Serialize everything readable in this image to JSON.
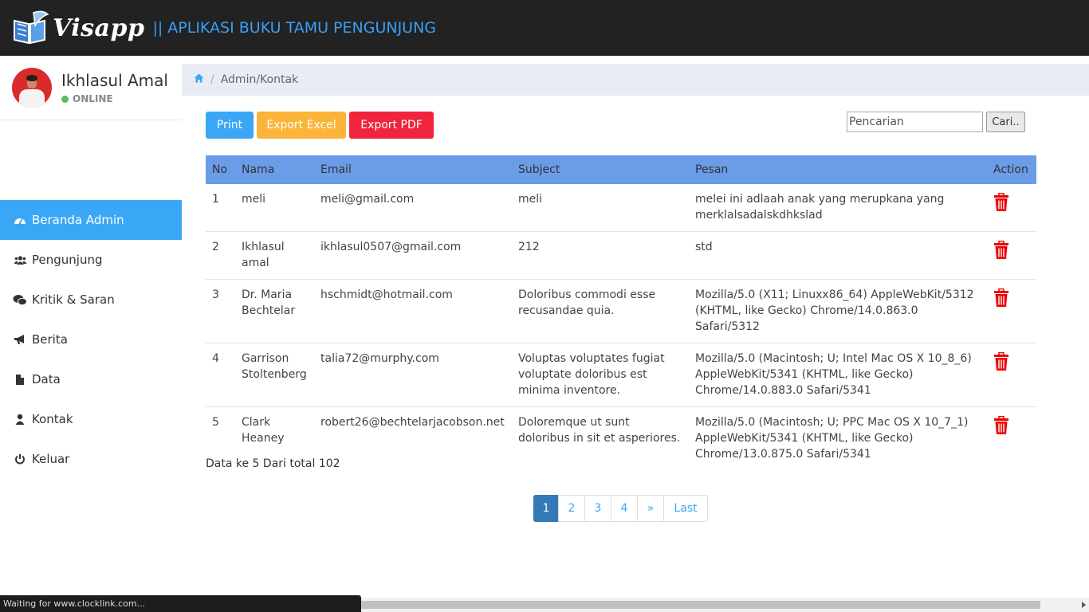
{
  "header": {
    "logo_text": "Visapp",
    "app_title": "|| APLIKASI BUKU TAMU PENGUNJUNG",
    "accent_color": "#3a9ff5"
  },
  "user": {
    "name": "Ikhlasul Amal",
    "status": "ONLINE"
  },
  "sidebar": {
    "items": [
      {
        "label": "Beranda Admin",
        "icon": "dashboard-icon",
        "active": true
      },
      {
        "label": "Pengunjung",
        "icon": "users-icon",
        "active": false
      },
      {
        "label": "Kritik & Saran",
        "icon": "chat-icon",
        "active": false
      },
      {
        "label": "Berita",
        "icon": "bullhorn-icon",
        "active": false
      },
      {
        "label": "Data",
        "icon": "file-icon",
        "active": false
      },
      {
        "label": "Kontak",
        "icon": "user-icon",
        "active": false
      },
      {
        "label": "Keluar",
        "icon": "power-icon",
        "active": false
      }
    ]
  },
  "breadcrumb": {
    "path": "Admin/Kontak"
  },
  "toolbar": {
    "print_label": "Print",
    "excel_label": "Export Excel",
    "pdf_label": "Export PDF",
    "search_placeholder": "Pencarian",
    "search_button": "Cari.."
  },
  "table": {
    "headers": [
      "No",
      "Nama",
      "Email",
      "Subject",
      "Pesan",
      "Action"
    ],
    "rows": [
      {
        "no": "1",
        "nama": "meli",
        "email": "meli@gmail.com",
        "subject": "meli",
        "pesan": "melei ini adlaah anak yang merupkana yang merklalsadalskdhkslad"
      },
      {
        "no": "2",
        "nama": "Ikhlasul amal",
        "email": "ikhlasul0507@gmail.com",
        "subject": "212",
        "pesan": "std"
      },
      {
        "no": "3",
        "nama": "Dr. Maria Bechtelar",
        "email": "hschmidt@hotmail.com",
        "subject": "Doloribus commodi esse recusandae quia.",
        "pesan": "Mozilla/5.0 (X11; Linuxx86_64) AppleWebKit/5312 (KHTML, like Gecko) Chrome/14.0.863.0 Safari/5312"
      },
      {
        "no": "4",
        "nama": "Garrison Stoltenberg",
        "email": "talia72@murphy.com",
        "subject": "Voluptas voluptates fugiat voluptate doloribus est minima inventore.",
        "pesan": "Mozilla/5.0 (Macintosh; U; Intel Mac OS X 10_8_6) AppleWebKit/5341 (KHTML, like Gecko) Chrome/14.0.883.0 Safari/5341"
      },
      {
        "no": "5",
        "nama": "Clark Heaney",
        "email": "robert26@bechtelarjacobson.net",
        "subject": "Doloremque ut sunt doloribus in sit et asperiores.",
        "pesan": "Mozilla/5.0 (Macintosh; U; PPC Mac OS X 10_7_1) AppleWebKit/5341 (KHTML, like Gecko) Chrome/13.0.875.0 Safari/5341"
      }
    ]
  },
  "data_info": "Data ke 5 Dari total 102",
  "pagination": {
    "pages": [
      "1",
      "2",
      "3",
      "4",
      "»",
      "Last"
    ],
    "active": "1"
  },
  "status_bar": "Waiting for www.clocklink.com..."
}
